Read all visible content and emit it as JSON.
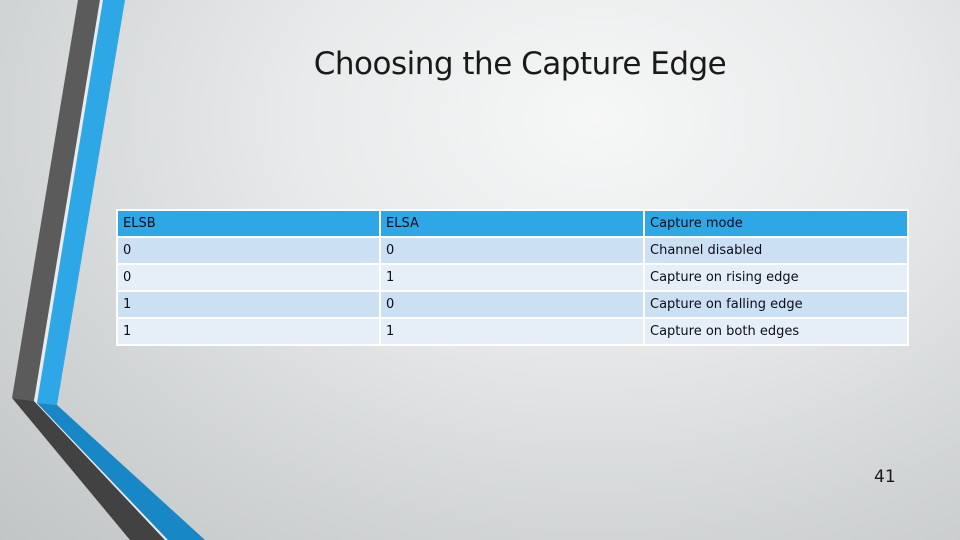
{
  "slide": {
    "title": "Choosing the Capture Edge",
    "page_number": "41"
  },
  "table": {
    "headers": [
      "ELSB",
      "ELSA",
      "Capture mode"
    ],
    "rows": [
      [
        "0",
        "0",
        "Channel disabled"
      ],
      [
        "0",
        "1",
        "Capture on rising edge"
      ],
      [
        "1",
        "0",
        "Capture on falling edge"
      ],
      [
        "1",
        "1",
        "Capture on both edges"
      ]
    ]
  },
  "theme": {
    "accent_blue": "#2ea7e6",
    "accent_dark_blue": "#1787c6",
    "accent_gray": "#5a5a5a",
    "row_odd": "#cbe0f3",
    "row_even": "#e6eef8"
  }
}
